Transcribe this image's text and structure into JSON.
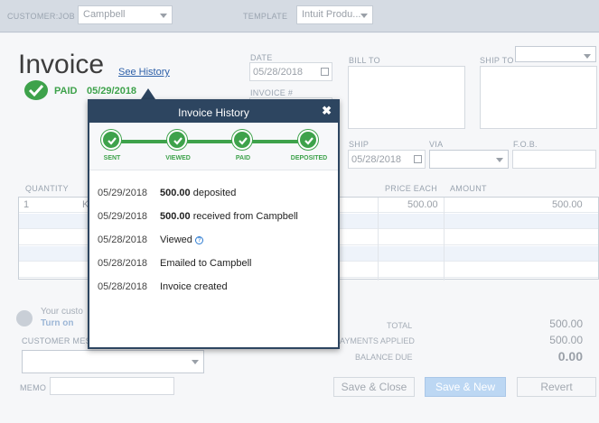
{
  "header": {
    "customer_job_label": "CUSTOMER:JOB",
    "customer_job_value": "Campbell",
    "template_label": "TEMPLATE",
    "template_value": "Intuit Produ..."
  },
  "invoice": {
    "title": "Invoice",
    "history_link": "See History",
    "status": "PAID",
    "status_date": "05/29/2018",
    "date_label": "DATE",
    "date_value": "05/28/2018",
    "invoice_no_label": "INVOICE #",
    "bill_to_label": "BILL TO",
    "ship_to_label": "SHIP TO",
    "ship_label": "SHIP",
    "ship_value": "05/28/2018",
    "via_label": "VIA",
    "fob_label": "F.O.B."
  },
  "table": {
    "headers": {
      "quantity": "QUANTITY",
      "price_each": "PRICE EACH",
      "amount": "AMOUNT"
    },
    "row1": {
      "quantity": "1",
      "item": "K",
      "price_each": "500.00",
      "amount": "500.00"
    }
  },
  "footer": {
    "customer_message_note": "Your custo",
    "turn_on": "Turn on",
    "customer_message_label": "CUSTOMER MESS",
    "memo_label": "MEMO",
    "total_label": "TOTAL",
    "total_value": "500.00",
    "payments_label": "AYMENTS APPLIED",
    "payments_value": "500.00",
    "balance_label": "BALANCE DUE",
    "balance_value": "0.00",
    "save_close": "Save & Close",
    "save_new": "Save & New",
    "revert": "Revert"
  },
  "history": {
    "title": "Invoice History",
    "close": "✖",
    "steps": [
      "SENT",
      "VIEWED",
      "PAID",
      "DEPOSITED"
    ],
    "entries": [
      {
        "date": "05/29/2018",
        "amount": "500.00",
        "text": " deposited"
      },
      {
        "date": "05/29/2018",
        "amount": "500.00",
        "text": " received from Campbell"
      },
      {
        "date": "05/28/2018",
        "amount": "",
        "text": "Viewed"
      },
      {
        "date": "05/28/2018",
        "amount": "",
        "text": "Emailed to Campbell"
      },
      {
        "date": "05/28/2018",
        "amount": "",
        "text": "Invoice created"
      }
    ]
  },
  "colors": {
    "paid_green": "#3ea24b",
    "popup_header": "#2d4560",
    "link_blue": "#2c5fa8"
  }
}
